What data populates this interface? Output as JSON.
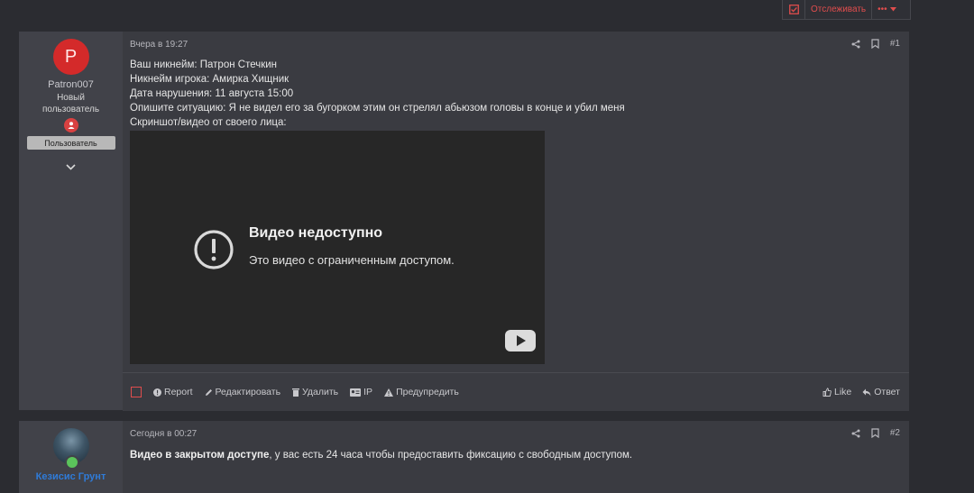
{
  "thread_actions": {
    "watch_label": "Отслеживать",
    "more_label": "•••"
  },
  "posts": [
    {
      "author": {
        "avatar_letter": "P",
        "username": "Patron007",
        "title": "Новый пользователь",
        "role_banner": "Пользователь"
      },
      "timestamp": "Вчера в 19:27",
      "post_number": "#1",
      "lines": [
        "Ваш никнейм: Патрон Стечкин",
        "Никнейм игрока: Амирка Хищник",
        "Дата нарушения: 11 августа 15:00",
        "Опишите ситуацию: Я не видел его за бугорком этим он стрелял абьюзом головы в конце и убил меня",
        "Скриншот/видео от своего лица:"
      ],
      "video": {
        "title": "Видео недоступно",
        "subtitle": "Это видео с ограниченным доступом."
      },
      "footer": {
        "report": "Report",
        "edit": "Редактировать",
        "delete": "Удалить",
        "ip": "IP",
        "warn": "Предупредить",
        "like": "Like",
        "reply": "Ответ"
      }
    },
    {
      "author": {
        "username": "Кезисис Грунт"
      },
      "timestamp": "Сегодня в 00:27",
      "post_number": "#2",
      "body_bold": "Видео в закрытом доступе",
      "body_rest": ", у вас есть 24 часа чтобы предоставить фиксацию с свободным доступом."
    }
  ],
  "colors": {
    "accent_red": "#e04d4d",
    "avatar_red": "#d42a2a",
    "link_blue": "#2f7bd8"
  }
}
